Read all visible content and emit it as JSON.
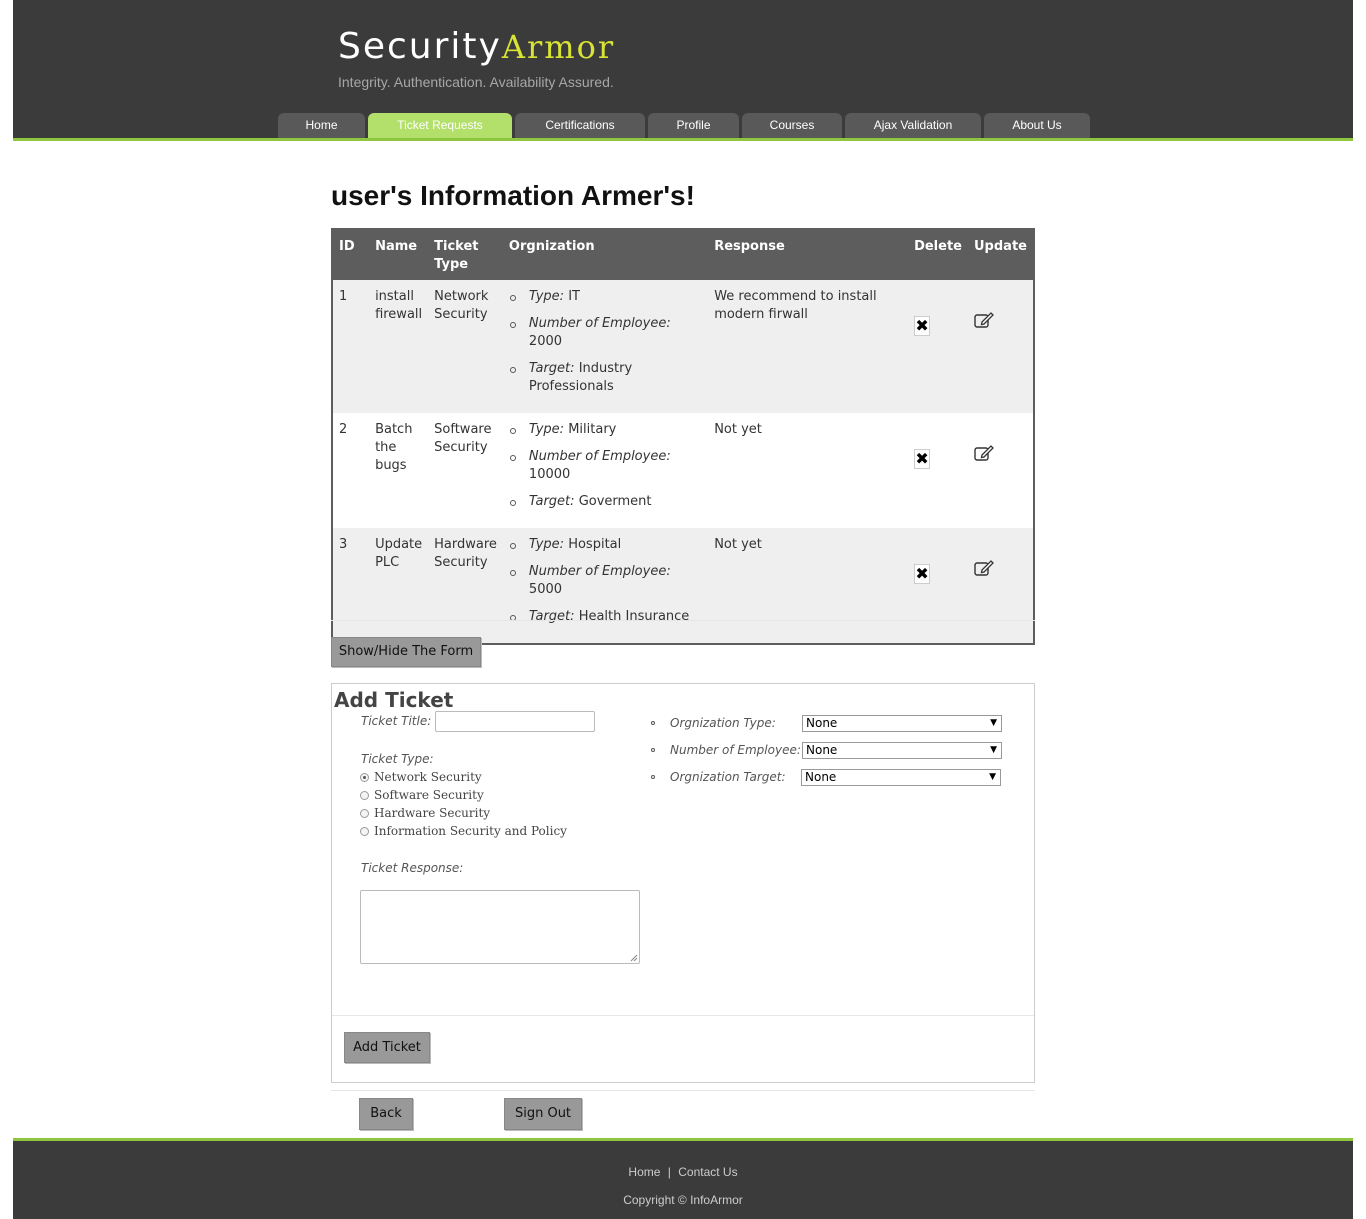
{
  "brand": {
    "word1": "Security",
    "word2": "Armor",
    "tagline": "Integrity. Authentication. Availability Assured."
  },
  "nav": [
    {
      "label": "Home"
    },
    {
      "label": "Ticket Requests"
    },
    {
      "label": "Certifications"
    },
    {
      "label": "Profile"
    },
    {
      "label": "Courses"
    },
    {
      "label": "Ajax Validation"
    },
    {
      "label": "About Us"
    }
  ],
  "page_title": "user's Information Armer's!",
  "table": {
    "headers": {
      "id": "ID",
      "name": "Name",
      "ticket_type": "Ticket Type",
      "org": "Orgnization",
      "response": "Response",
      "delete": "Delete",
      "update": "Update"
    },
    "org_labels": {
      "type": "Type:",
      "employees": "Number of Employee:",
      "target": "Target:"
    },
    "rows": [
      {
        "id": "1",
        "name": "install firewall",
        "ticket_type": "Network Security",
        "org_type": "IT",
        "employees": "2000",
        "target": "Industry Professionals",
        "response": "We recommend to install modern firwall"
      },
      {
        "id": "2",
        "name": "Batch the bugs",
        "ticket_type": "Software Security",
        "org_type": "Military",
        "employees": "10000",
        "target": "Goverment",
        "response": "Not yet"
      },
      {
        "id": "3",
        "name": "Update PLC",
        "ticket_type": "Hardware Security",
        "org_type": "Hospital",
        "employees": "5000",
        "target": "Health Insurance",
        "response": "Not yet"
      }
    ]
  },
  "toggle_form_label": "Show/Hide The Form",
  "form": {
    "title": "Add Ticket",
    "ticket_title_label": "Ticket Title:",
    "ticket_title_value": "",
    "ticket_type_label": "Ticket Type:",
    "ticket_types": [
      "Network Security",
      "Software Security",
      "Hardware Security",
      "Information Security and Policy"
    ],
    "ticket_response_label": "Ticket Response:",
    "org_type_label": "Orgnization Type:",
    "org_type_value": "None",
    "employees_label": "Number of Employee:",
    "employees_value": "None",
    "target_label": "Orgnization Target:",
    "target_value": "None",
    "submit_label": "Add Ticket"
  },
  "back_label": "Back",
  "signout_label": "Sign Out",
  "footer": {
    "home": "Home",
    "separator": "|",
    "contact": "Contact Us",
    "copyright": "Copyright © InfoArmor"
  },
  "colors": {
    "header_bg": "#3b3b3b",
    "accent_green": "#8ec63f",
    "active_tab": "#b3df6b",
    "logo_yellow": "#d7e335",
    "table_header": "#5d5d5d"
  }
}
